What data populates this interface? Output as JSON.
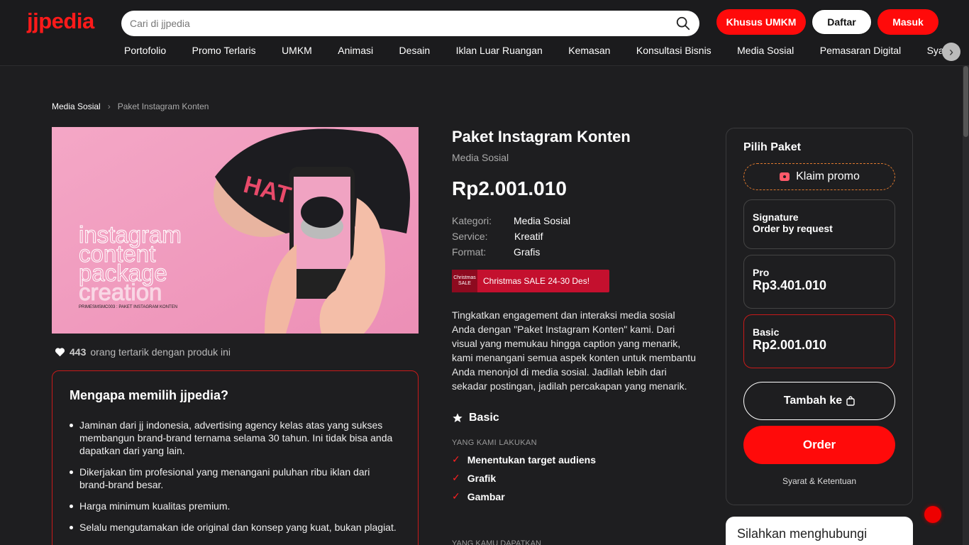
{
  "header": {
    "logo": "jjpedia",
    "search_placeholder": "Cari di jjpedia",
    "btn_umkm": "Khusus UMKM",
    "btn_daftar": "Daftar",
    "btn_masuk": "Masuk",
    "nav": [
      "Portofolio",
      "Promo Terlaris",
      "UMKM",
      "Animasi",
      "Desain",
      "Iklan Luar Ruangan",
      "Kemasan",
      "Konsultasi Bisnis",
      "Media Sosial",
      "Pemasaran Digital",
      "Syarat"
    ]
  },
  "breadcrumb": {
    "parent": "Media Sosial",
    "current": "Paket Instagram Konten"
  },
  "image": {
    "lines": [
      "instagram",
      "content",
      "package",
      "creation"
    ],
    "code": "PRIMESMSMC003 : PAKET INSTAGRAM KONTEN",
    "hat_text": "HAT"
  },
  "interest": {
    "count": "443",
    "text": "orang tertarik dengan produk ini"
  },
  "why": {
    "title": "Mengapa memilih jjpedia?",
    "items": [
      "Jaminan dari jj indonesia, advertising agency kelas atas yang sukses membangun brand-brand ternama selama 30 tahun. Ini tidak bisa anda dapatkan dari yang lain.",
      "Dikerjakan tim profesional yang menangani puluhan ribu iklan dari brand-brand besar.",
      "Harga minimum kualitas premium.",
      "Selalu mengutamakan ide original dan konsep yang kuat, bukan plagiat."
    ]
  },
  "product": {
    "title": "Paket Instagram Konten",
    "category": "Media Sosial",
    "price": "Rp2.001.010",
    "specs": [
      {
        "k": "Kategori:",
        "v": "Media Sosial"
      },
      {
        "k": "Service:",
        "v": "Kreatif"
      },
      {
        "k": "Format:",
        "v": "Grafis"
      }
    ],
    "promo_tag": "Christmas SALE",
    "promo_text": "Christmas SALE 24-30 Des!",
    "description": "Tingkatkan engagement dan interaksi media sosial Anda dengan \"Paket Instagram Konten\" kami. Dari visual yang memukau hingga caption yang menarik, kami menangani semua aspek konten untuk membantu Anda menonjol di media sosial. Jadilah lebih dari sekadar postingan, jadilah percakapan yang menarik.",
    "package_name": "Basic",
    "what_we_do_label": "YANG KAMI LAKUKAN",
    "features": [
      "Menentukan target audiens",
      "Grafik",
      "Gambar"
    ],
    "what_you_get_label": "YANG KAMU DAPATKAN"
  },
  "panel": {
    "title": "Pilih Paket",
    "claim": "Klaim promo",
    "options": [
      {
        "name": "Signature",
        "price": "Order by request"
      },
      {
        "name": "Pro",
        "price": "Rp3.401.010"
      },
      {
        "name": "Basic",
        "price": "Rp2.001.010"
      }
    ],
    "add_label": "Tambah ke",
    "order_label": "Order",
    "terms": "Syarat & Ketentuan"
  },
  "contact": {
    "text": "Silahkan menghubungi"
  },
  "colors": {
    "accent": "#ff0a0a",
    "background": "#1e1e20"
  }
}
